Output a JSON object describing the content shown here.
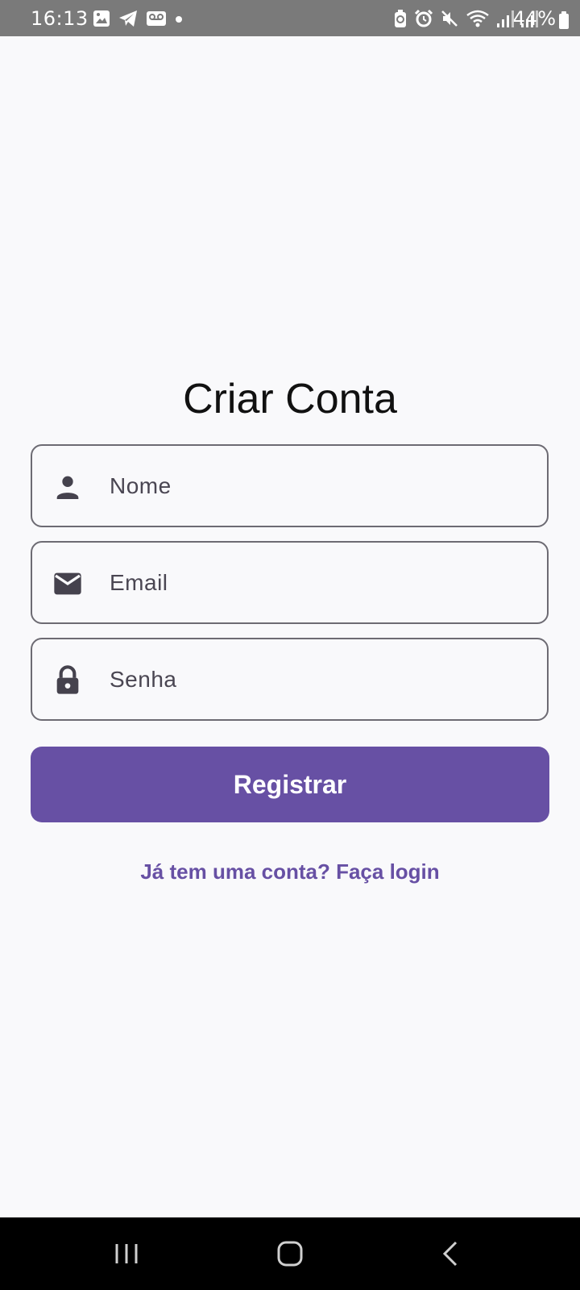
{
  "status_bar": {
    "time": "16:13",
    "battery": "44%",
    "left_icons": [
      "gallery-icon",
      "telegram-icon",
      "voicemail-icon",
      "dot-icon"
    ],
    "right_icons": [
      "battery-saver-icon",
      "alarm-icon",
      "mute-icon",
      "wifi-icon",
      "signal-icon",
      "signal-icon"
    ]
  },
  "page": {
    "title": "Criar Conta"
  },
  "form": {
    "name_placeholder": "Nome",
    "email_placeholder": "Email",
    "password_placeholder": "Senha",
    "submit_label": "Registrar"
  },
  "footer": {
    "login_link": "Já tem uma conta? Faça login"
  },
  "nav_bar": {
    "buttons": [
      "recents-icon",
      "home-icon",
      "back-icon"
    ]
  },
  "colors": {
    "primary": "#6750a4",
    "background": "#f9f9fb",
    "outline": "#6d6b73",
    "icon": "#45424d"
  }
}
